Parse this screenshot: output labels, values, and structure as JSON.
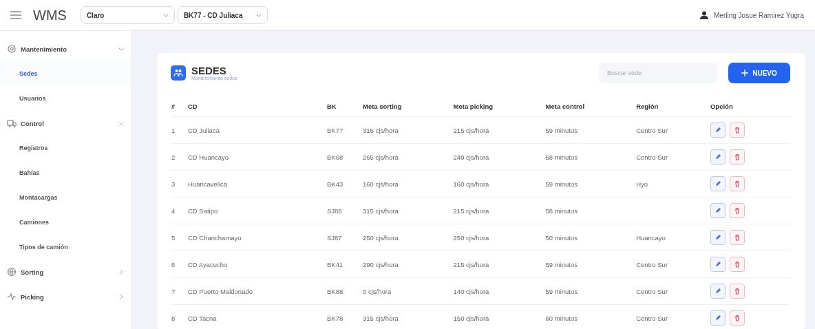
{
  "header": {
    "logo": "WMS",
    "selects": [
      {
        "value": "Claro"
      },
      {
        "value": "BK77 - CD Juliaca"
      }
    ],
    "user": "Merling Josue Ramirez Yugra"
  },
  "sidebar": {
    "groups": [
      {
        "label": "Mantenimiento",
        "expanded": true,
        "children": [
          {
            "label": "Sedes",
            "selected": true
          },
          {
            "label": "Usuarios",
            "selected": false
          }
        ]
      },
      {
        "label": "Control",
        "expanded": true,
        "children": [
          {
            "label": "Registros",
            "selected": false
          },
          {
            "label": "Bahías",
            "selected": false
          },
          {
            "label": "Montacargas",
            "selected": false
          },
          {
            "label": "Camiones",
            "selected": false
          },
          {
            "label": "Tipos de camión",
            "selected": false
          }
        ]
      },
      {
        "label": "Sorting",
        "expanded": false
      },
      {
        "label": "Picking",
        "expanded": false
      }
    ]
  },
  "page": {
    "title": "SEDES",
    "subtitle": "Mantenimiento sedes",
    "search": {
      "placeholder": "Buscar sede"
    },
    "new_button": "NUEVO"
  },
  "table": {
    "columns": [
      "#",
      "CD",
      "BK",
      "Meta sorting",
      "Meta picking",
      "Meta control",
      "Región",
      "Opción"
    ],
    "rows": [
      {
        "n": "1",
        "cd": "CD Juliaca",
        "bk": "BK77",
        "sorting": "315 cjs/hora",
        "picking": "215 cjs/hora",
        "control": "59 minutos",
        "region": "Centro Sur"
      },
      {
        "n": "2",
        "cd": "CD Huancayo",
        "bk": "BK68",
        "sorting": "265 cjs/hora",
        "picking": "240 cjs/hora",
        "control": "58 minutos",
        "region": "Centro Sur"
      },
      {
        "n": "3",
        "cd": "Huancavelica",
        "bk": "BK43",
        "sorting": "160 cjs/hora",
        "picking": "160 cjs/hora",
        "control": "59 minutos",
        "region": "Hyo"
      },
      {
        "n": "4",
        "cd": "CD Satipo",
        "bk": "SJ88",
        "sorting": "315 cjs/hora",
        "picking": "215 cjs/hora",
        "control": "58 minutos"
      },
      {
        "n": "5",
        "cd": "CD Chanchamayo",
        "bk": "SJ87",
        "sorting": "250 cjs/hora",
        "picking": "250 cjs/hora",
        "control": "50 minutos",
        "region": "Huancayo"
      },
      {
        "n": "6",
        "cd": "CD Ayacucho",
        "bk": "BK41",
        "sorting": "290 cjs/hora",
        "picking": "215 cjs/hora",
        "control": "59 minutos",
        "region": "Centro Sur"
      },
      {
        "n": "7",
        "cd": "CD Puerto Maldonado",
        "bk": "BK88",
        "sorting": "0 cjs/hora",
        "picking": "140 cjs/hora",
        "control": "59 minutos",
        "region": "Centro Sur"
      },
      {
        "n": "8",
        "cd": "CD Tacna",
        "bk": "BK78",
        "sorting": "315 cjs/hora",
        "picking": "150 cjs/hora",
        "control": "60 minutos",
        "region": "Centro Sur"
      }
    ]
  }
}
